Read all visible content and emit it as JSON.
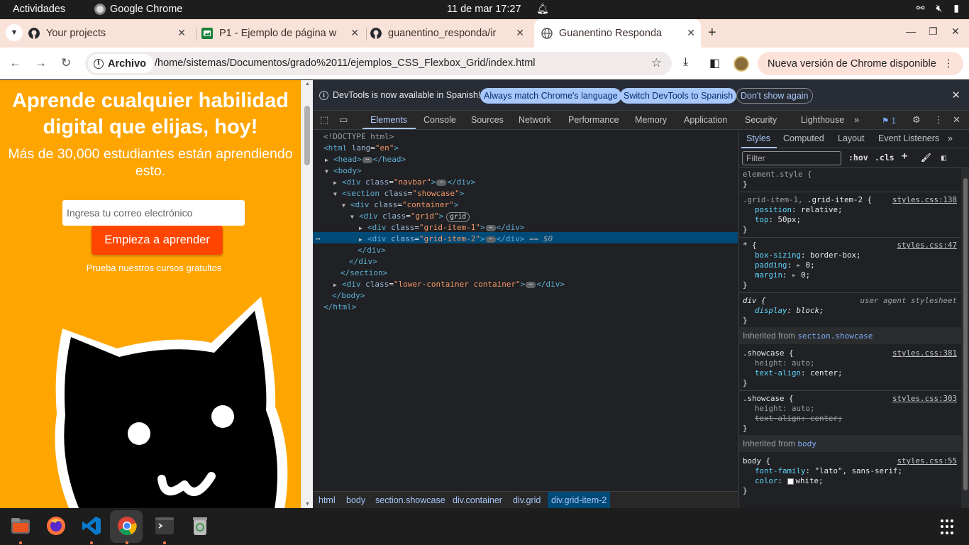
{
  "topbar": {
    "activities": "Actividades",
    "app_name": "Google Chrome",
    "clock": "11 de mar  17:27"
  },
  "tabs": [
    {
      "title": "Your projects",
      "icon": "github-icon"
    },
    {
      "title": "P1 - Ejemplo de página w",
      "icon": "sheets-icon"
    },
    {
      "title": "guanentino_responda/ir",
      "icon": "github-icon"
    },
    {
      "title": "Guanentino Responda",
      "icon": "globe-icon",
      "active": true
    }
  ],
  "toolbar": {
    "site_label": "Archivo",
    "url": "/home/sistemas/Documentos/grado%2011/ejemplos_CSS_Flexbox_Grid/index.html",
    "update_label": "Nueva versión de Chrome disponible"
  },
  "page": {
    "headline": "Aprende cualquier habilidad digital que elijas, hoy!",
    "subhead": "Más de 30,000 estudiantes están aprendiendo esto.",
    "email_placeholder": "Ingresa tu correo electrónico",
    "cta_label": "Empieza a aprender",
    "free_courses": "Prueba nuestros cursos gratultos",
    "colors": {
      "background": "#ffa500",
      "cta": "#ff4500"
    }
  },
  "devtools": {
    "infobar": {
      "message": "DevTools is now available in Spanish!",
      "btn_match": "Always match Chrome's language",
      "btn_switch": "Switch DevTools to Spanish",
      "btn_dismiss": "Don't show again"
    },
    "tabs": [
      "Elements",
      "Console",
      "Sources",
      "Network",
      "Performance",
      "Memory",
      "Application",
      "Security",
      "Lighthouse"
    ],
    "issues_count": "1",
    "dom": {
      "doctype": "<!DOCTYPE html>",
      "html_open_tag": "<html",
      "lang_attr": "lang",
      "lang_val": "\"en\"",
      "head_open": "<head>",
      "head_close": "</head>",
      "body_open": "<body>",
      "navbar_open": "<div",
      "class_attr": "class",
      "navbar_val": "\"navbar\"",
      "div_close": "</div>",
      "section_open": "<section",
      "showcase_val": "\"showcase\"",
      "container_val": "\"container\"",
      "grid_val": "\"grid\"",
      "grid_badge": "grid",
      "gi1_val": "\"grid-item-1\"",
      "gi2_val": "\"grid-item-2\"",
      "selected_marker": "== $0",
      "section_close": "</section>",
      "lower_val": "\"lower-container container\"",
      "body_close": "</body>",
      "html_close": "</html>",
      "gt": ">"
    },
    "breadcrumbs": [
      "html",
      "body",
      "section.showcase",
      "div.container",
      "div.grid",
      "div.grid-item-2"
    ],
    "styles_tabs": [
      "Styles",
      "Computed",
      "Layout",
      "Event Listeners"
    ],
    "filter_placeholder": "Filter",
    "hov": ":hov",
    "cls": ".cls",
    "rules": {
      "element_style": "element.style {",
      "r1_selector_dim": ".grid-item-1,",
      "r1_selector": ".grid-item-2 {",
      "r1_src": "styles.css:138",
      "r1_p1": "position",
      "r1_v1": "relative;",
      "r1_p2": "top",
      "r1_v2": "50px;",
      "r2_selector": "* {",
      "r2_src": "styles.css:47",
      "r2_p1": "box-sizing",
      "r2_v1": "border-box;",
      "r2_p2": "padding",
      "r2_v2": "0;",
      "r2_p3": "margin",
      "r2_v3": "0;",
      "r3_selector": "div {",
      "r3_src": "user agent stylesheet",
      "r3_p1": "display",
      "r3_v1": "block;",
      "inh1_label": "Inherited from",
      "inh1_link": "section.showcase",
      "r4_selector": ".showcase {",
      "r4_src": "styles.css:381",
      "r4_p1": "height",
      "r4_v1": "auto;",
      "r4_p2": "text-align",
      "r4_v2": "center;",
      "r5_selector": ".showcase {",
      "r5_src": "styles.css:303",
      "r5_p1": "height",
      "r5_v1": "auto;",
      "r5_p2": "text-align",
      "r5_v2": "center;",
      "inh2_label": "Inherited from",
      "inh2_link": "body",
      "r6_selector": "body {",
      "r6_src": "styles.css:55",
      "r6_p1": "font-family",
      "r6_v1": "\"lato\", sans-serif;",
      "r6_p2": "color",
      "r6_v2": "white;",
      "close_brace": "}"
    }
  },
  "dock": [
    "files-icon",
    "firefox-icon",
    "vscode-icon",
    "chrome-icon",
    "terminal-icon",
    "trash-icon",
    "apps-grid-icon"
  ]
}
